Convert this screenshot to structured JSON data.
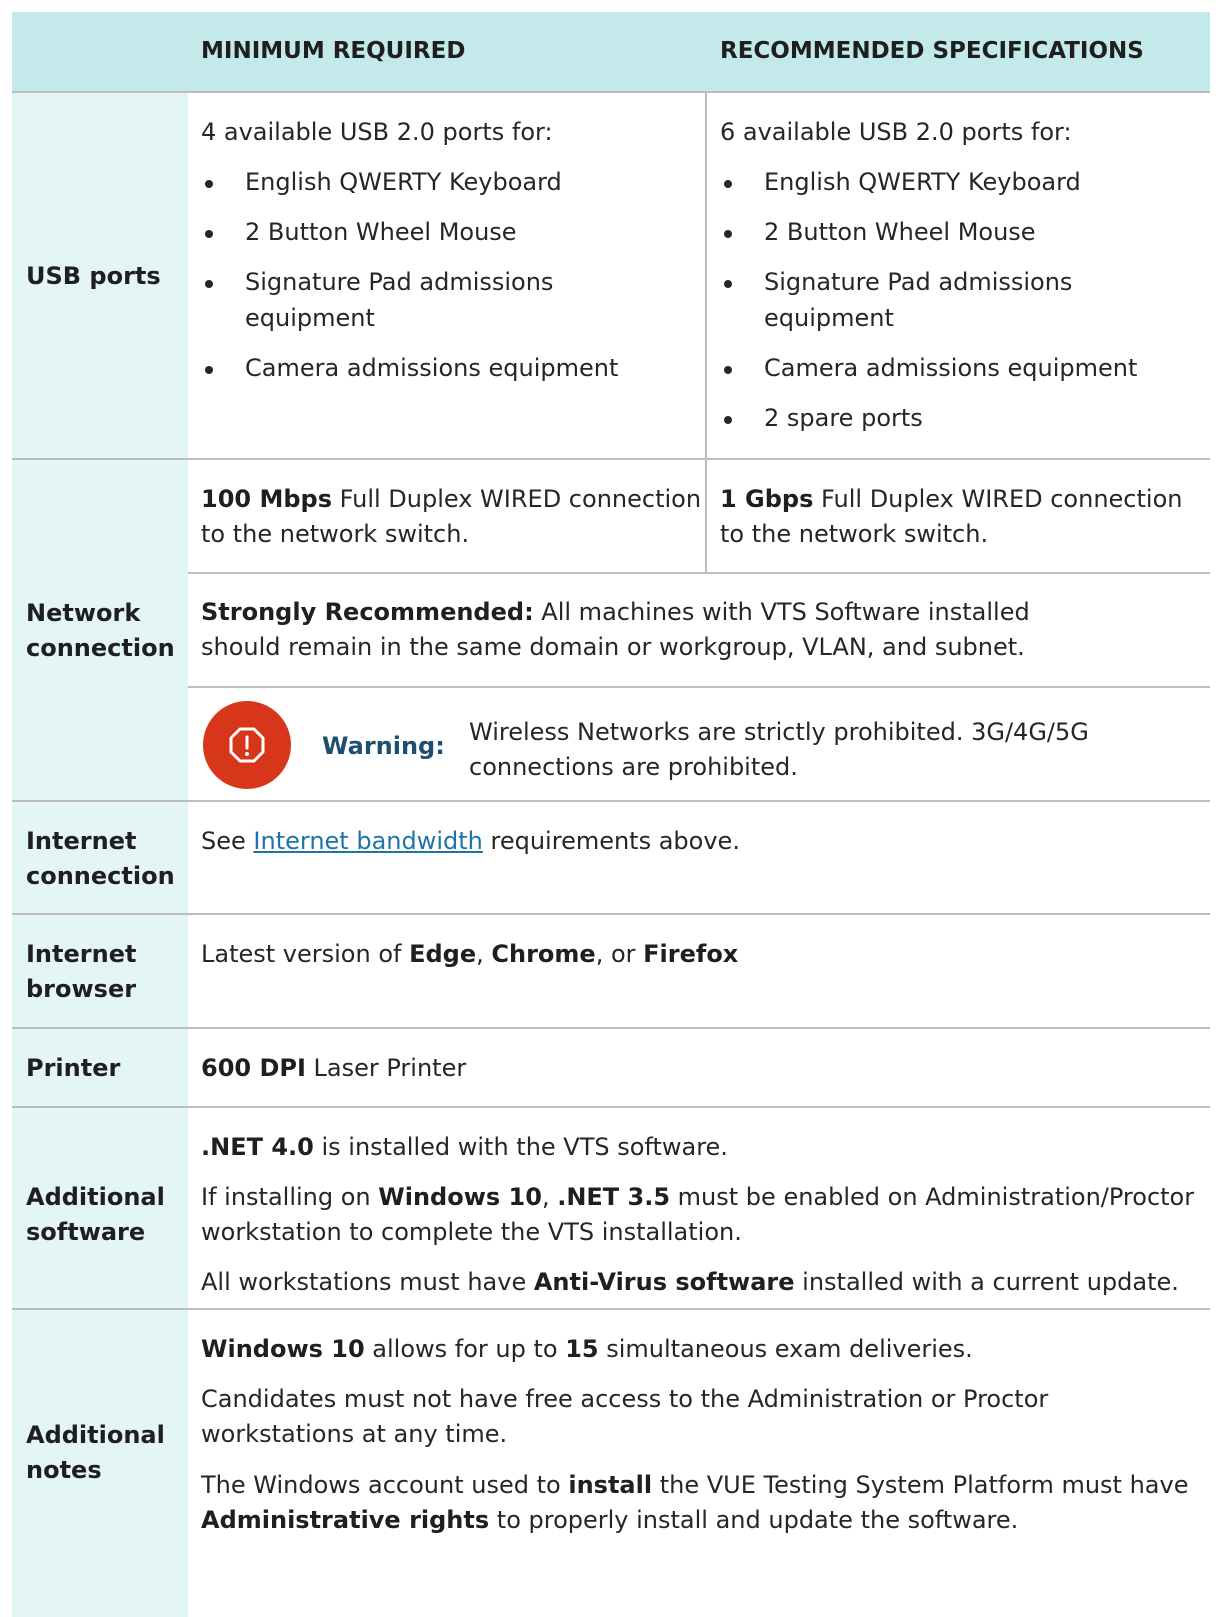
{
  "header": {
    "col_min": "MINIMUM REQUIRED",
    "col_rec": "RECOMMENDED SPECIFICATIONS"
  },
  "usb": {
    "label": "USB ports",
    "min_intro": "4 available USB 2.0 ports for:",
    "min_items": [
      "English QWERTY Keyboard",
      "2 Button Wheel Mouse",
      "Signature Pad admissions",
      "equipment",
      "Camera admissions equipment"
    ],
    "rec_intro": "6 available USB 2.0 ports for:",
    "rec_items": [
      "English QWERTY Keyboard",
      "2 Button Wheel Mouse",
      "Signature Pad admissions",
      "equipment",
      "Camera admissions equipment",
      "2 spare ports"
    ]
  },
  "network": {
    "label_1": "Network",
    "label_2": "connection",
    "min_bold": "100 Mbps",
    "min_rest": " Full Duplex WIRED connection",
    "min_line2": "to the network switch.",
    "rec_bold": "1 Gbps",
    "rec_rest": " Full Duplex WIRED connection",
    "rec_line2": "to the network switch.",
    "strong_bold": "Strongly Recommended:",
    "strong_rest": " All machines with VTS Software installed",
    "strong_line2": "should remain in the same domain or workgroup, VLAN, and subnet.",
    "warning_label": "Warning:",
    "warning_line1": "Wireless Networks are strictly prohibited. 3G/4G/5G",
    "warning_line2": "connections are prohibited.",
    "warning_icon": "warning-octagon-icon"
  },
  "internet": {
    "label_1": "Internet",
    "label_2": "connection",
    "pre": "See ",
    "link": "Internet bandwidth",
    "post": " requirements above."
  },
  "browser": {
    "label_1": "Internet",
    "label_2": "browser",
    "pre": "Latest version of ",
    "b1": "Edge",
    "s1": ", ",
    "b2": "Chrome",
    "s2": ", or ",
    "b3": "Firefox"
  },
  "printer": {
    "label": "Printer",
    "bold": "600 DPI",
    "rest": " Laser Printer"
  },
  "software": {
    "label_1": "Additional",
    "label_2": "software",
    "net_bold": ".NET 4.0",
    "net_rest": " is installed with the VTS software.",
    "if_pre": "If installing on ",
    "if_b1": "Windows 10",
    "if_s1": ", ",
    "if_b2": ".NET 3.5",
    "if_rest": " must be enabled on Administration/Proctor",
    "if_line2": "workstation to complete the VTS installation.",
    "av_pre": "All workstations must have ",
    "av_bold": "Anti-Virus software",
    "av_rest": " installed with a current update."
  },
  "notes": {
    "label_1": "Additional",
    "label_2": "notes",
    "w_bold": "Windows 10",
    "w_mid": " allows for up to ",
    "w_num": "15",
    "w_rest": " simultaneous exam deliveries.",
    "c_line1": "Candidates must not have free access to the Administration or Proctor",
    "c_line2": "workstations at any time.",
    "a_pre": "The Windows account used to ",
    "a_bold": "install",
    "a_rest": " the VUE Testing System Platform must have",
    "a2_bold": "Administrative rights",
    "a2_rest": " to properly install and update the software."
  },
  "colors": {
    "header_bg": "#c3e9ea",
    "label_bg": "#e3f5f5",
    "warning": "#d8361a",
    "warning_text": "#1d4f6e",
    "link": "#1f73a8"
  }
}
